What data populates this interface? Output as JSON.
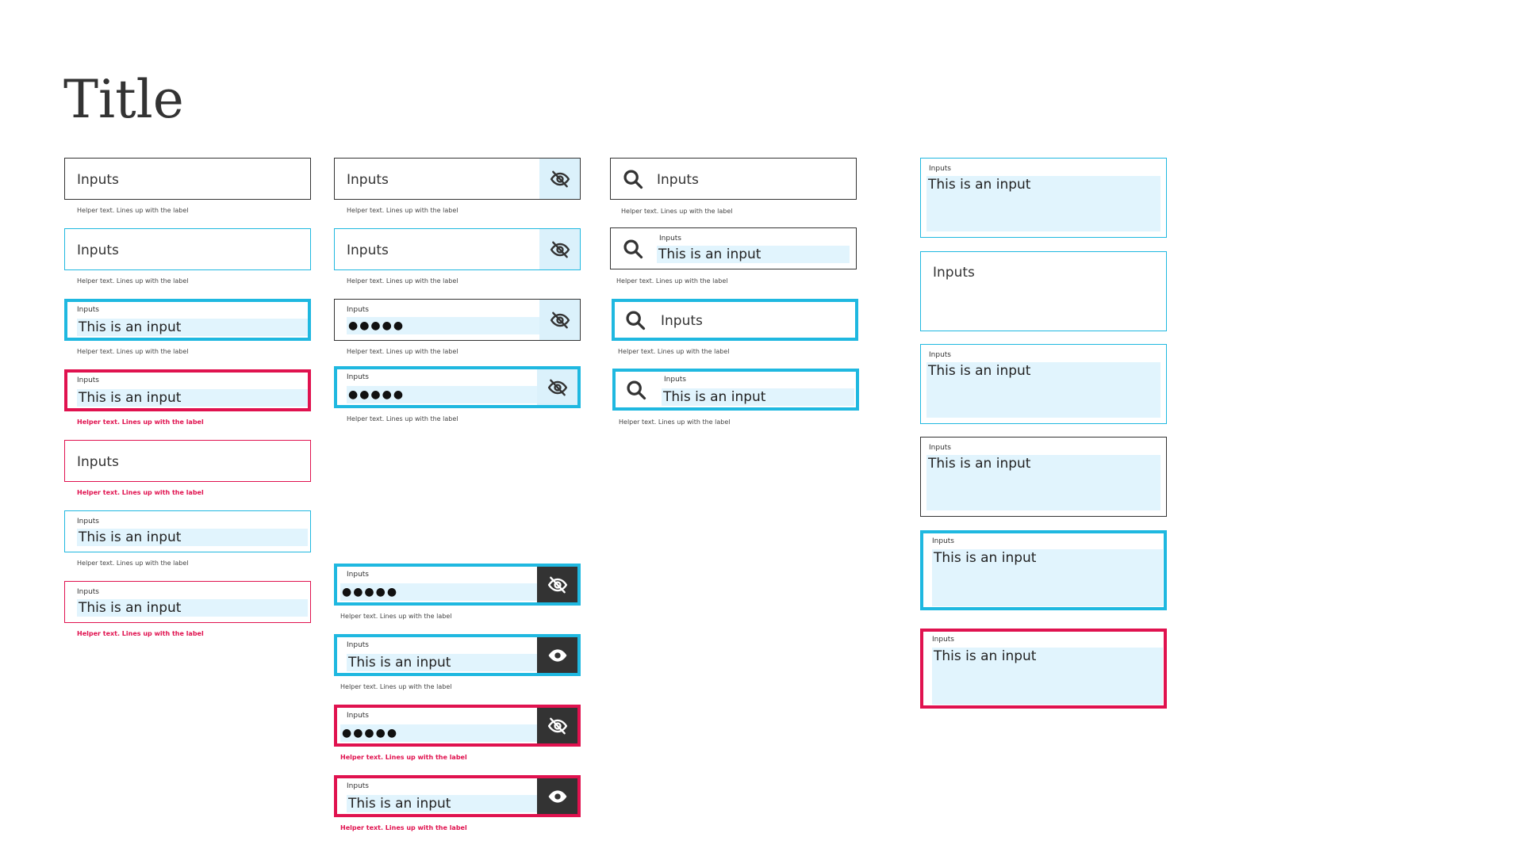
{
  "title": "Title",
  "placeholder": "Inputs",
  "field_label": "Inputs",
  "value_text": "This is an input",
  "password_mask": "●●●●●",
  "helper_text": "Helper text. Lines up with the label",
  "icons": [
    "eye-slash-icon",
    "eye-icon",
    "search-icon"
  ],
  "colors": {
    "focus": "#1fb8e0",
    "error": "#e0124f",
    "text": "#333333",
    "fill": "#e1f4fd",
    "toggle_dark": "#333333"
  }
}
